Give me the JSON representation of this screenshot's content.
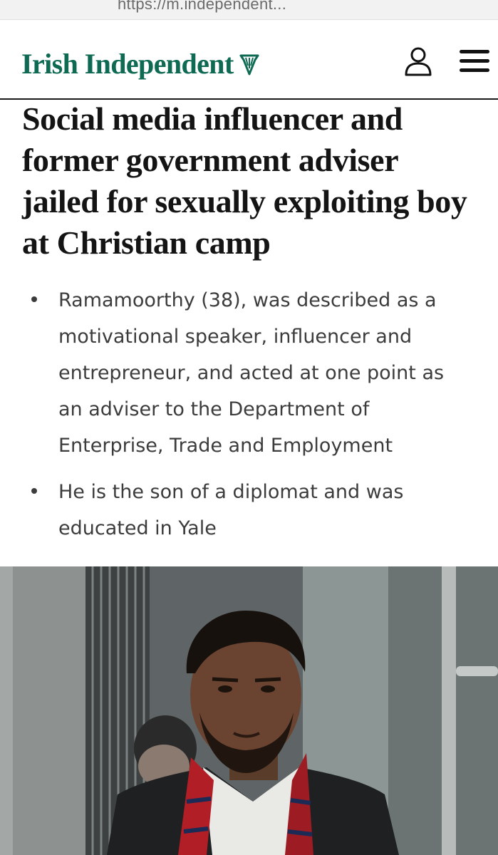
{
  "browser": {
    "url": "https://m.independent..."
  },
  "masthead": {
    "brand": "Irish Independent",
    "brand_color": "#0f6a53"
  },
  "article": {
    "headline": "Social media influencer and former government adviser jailed for sexually exploiting boy at Christian camp",
    "bullets": [
      "Ramamoorthy (38), was described as a motivational speaker, influencer and entrepreneur, and acted at one point as an adviser to the Department of Enterprise, Trade and Employment",
      "He is the son of a diplomat and was educated in Yale"
    ]
  },
  "icons": {
    "logo_mark": "harp-icon",
    "account": "user-icon",
    "menu": "hamburger-menu-icon"
  }
}
